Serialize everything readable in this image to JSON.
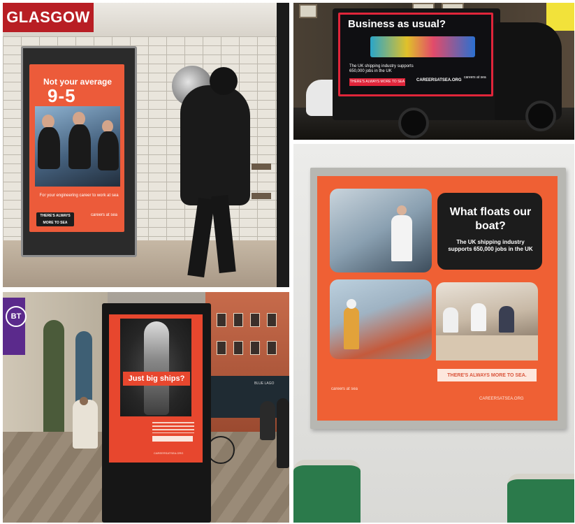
{
  "location_label": "GLASGOW",
  "photo_1": {
    "headline_top": "Not your average",
    "headline_big": "9-5",
    "tagline": "For your engineering career to work at sea",
    "badge": "THERE'S ALWAYS MORE TO SEA",
    "logo": "careers at sea"
  },
  "photo_2": {
    "headline": "Business as usual?",
    "body": "The UK shipping industry supports 650,000 jobs in the UK",
    "cta": "THERE'S ALWAYS MORE TO SEA",
    "url": "CAREERSATSEA.ORG",
    "logo": "careers at sea"
  },
  "photo_3": {
    "bt_logo": "BT",
    "headline": "Just big ships?",
    "url": "CAREERSATSEA.ORG",
    "shop_sign": "BLUE LAGO"
  },
  "photo_4": {
    "title": "What floats our boat?",
    "body": "The UK shipping industry supports 650,000 jobs in the UK",
    "cta": "THERE'S ALWAYS MORE TO SEA.",
    "logo": "careers at sea",
    "url": "CAREERSATSEA.ORG"
  },
  "colors": {
    "label_red": "#b81e24",
    "brand_orange": "#ef6034",
    "van_frame_red": "#e0253a"
  }
}
